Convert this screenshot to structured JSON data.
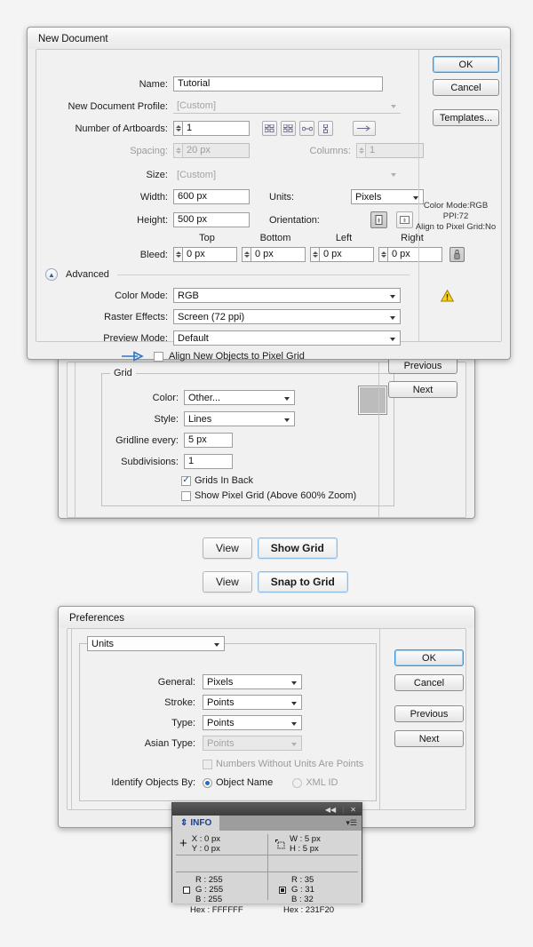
{
  "newdoc": {
    "title": "New Document",
    "name_label": "Name:",
    "name_value": "Tutorial",
    "profile_label": "New Document Profile:",
    "profile_value": "[Custom]",
    "artboards_label": "Number of Artboards:",
    "artboards_value": "1",
    "spacing_label": "Spacing:",
    "spacing_value": "20 px",
    "columns_label": "Columns:",
    "columns_value": "1",
    "size_label": "Size:",
    "size_value": "[Custom]",
    "width_label": "Width:",
    "width_value": "600 px",
    "height_label": "Height:",
    "height_value": "500 px",
    "units_label": "Units:",
    "units_value": "Pixels",
    "orientation_label": "Orientation:",
    "bleed_label": "Bleed:",
    "bleed_top_label": "Top",
    "bleed_bottom_label": "Bottom",
    "bleed_left_label": "Left",
    "bleed_right_label": "Right",
    "bleed_top_value": "0 px",
    "bleed_bottom_value": "0 px",
    "bleed_left_value": "0 px",
    "bleed_right_value": "0 px",
    "advanced_label": "Advanced",
    "colormode_label": "Color Mode:",
    "colormode_value": "RGB",
    "raster_label": "Raster Effects:",
    "raster_value": "Screen (72 ppi)",
    "preview_label": "Preview Mode:",
    "preview_value": "Default",
    "align_pixelgrid_label": "Align New Objects to Pixel Grid",
    "buttons": {
      "ok": "OK",
      "cancel": "Cancel",
      "templates": "Templates..."
    },
    "summary": [
      "Color Mode:RGB",
      "PPI:72",
      "Align to Pixel Grid:No"
    ]
  },
  "prefgrid": {
    "group_title": "Grid",
    "color_label": "Color:",
    "color_value": "Other...",
    "style_label": "Style:",
    "style_value": "Lines",
    "gridline_label": "Gridline every:",
    "gridline_value": "5 px",
    "subdivisions_label": "Subdivisions:",
    "subdivisions_value": "1",
    "grids_in_back_label": "Grids In Back",
    "show_pixel_grid_label": "Show Pixel Grid (Above 600% Zoom)",
    "swatch_color": "#bcbcbc",
    "buttons": {
      "previous": "Previous",
      "next": "Next"
    }
  },
  "menu_paths": [
    {
      "menu": "View",
      "item": "Show Grid"
    },
    {
      "menu": "View",
      "item": "Snap to Grid"
    }
  ],
  "prefunits": {
    "title": "Preferences",
    "section_value": "Units",
    "general_label": "General:",
    "general_value": "Pixels",
    "stroke_label": "Stroke:",
    "stroke_value": "Points",
    "type_label": "Type:",
    "type_value": "Points",
    "asian_label": "Asian Type:",
    "asian_value": "Points",
    "numbers_label": "Numbers Without Units Are Points",
    "identify_label": "Identify Objects By:",
    "identify_option1": "Object Name",
    "identify_option2": "XML ID",
    "buttons": {
      "ok": "OK",
      "cancel": "Cancel",
      "previous": "Previous",
      "next": "Next"
    }
  },
  "info_panel": {
    "tab_label": "INFO",
    "x_label": "X",
    "x_value": ": 0 px",
    "y_label": "Y",
    "y_value": ": 0 px",
    "w_label": "W",
    "w_value": ": 5 px",
    "h_label": "H",
    "h_value": ": 5 px",
    "fill": {
      "r_label": "R : 255",
      "g_label": "G : 255",
      "b_label": "B : 255",
      "hex_label": "Hex : FFFFFF"
    },
    "stroke": {
      "r_label": "R : 35",
      "g_label": "G : 31",
      "b_label": "B : 32",
      "hex_label": "Hex : 231F20"
    }
  }
}
